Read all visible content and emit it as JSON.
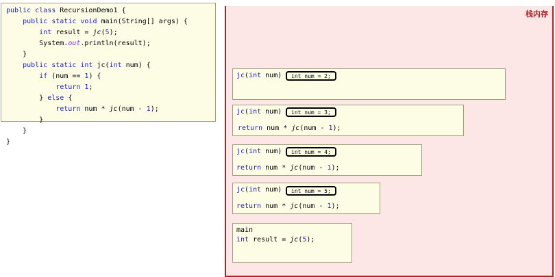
{
  "code_panel": {
    "lines": [
      {
        "t": "public class RecursionDemo1 {"
      },
      {
        "t": "    public static void main(String[] args) {"
      },
      {
        "t": "        int result = jc(5);"
      },
      {
        "t": "        System.out.println(result);"
      },
      {
        "t": "    }"
      },
      {
        "t": "    public static int jc(int num) {"
      },
      {
        "t": "        if (num == 1) {"
      },
      {
        "t": "            return 1;"
      },
      {
        "t": "        } else {"
      },
      {
        "t": "            return num * jc(num - 1);"
      },
      {
        "t": "        }"
      },
      {
        "t": "    }"
      },
      {
        "t": "}"
      }
    ]
  },
  "stack": {
    "title": "栈内存",
    "frames": [
      {
        "header": "jc(int num)",
        "param": "int num = 2;",
        "body": ""
      },
      {
        "header": "jc(int num)",
        "param": "int num = 3;",
        "body": "return num * jc(num - 1);"
      },
      {
        "header": "jc(int num)",
        "param": "int num = 4;",
        "body": "return num * jc(num - 1);"
      },
      {
        "header": "jc(int num)",
        "param": "int num = 5;",
        "body": "return num * jc(num - 1);"
      },
      {
        "header": "main",
        "param": "",
        "body": "int result = jc(5);"
      }
    ]
  },
  "colors": {
    "keyword": "#1f1fc0",
    "stack_border": "#b22222",
    "stack_bg": "#fde6e6",
    "frame_bg": "#fdfde6"
  }
}
